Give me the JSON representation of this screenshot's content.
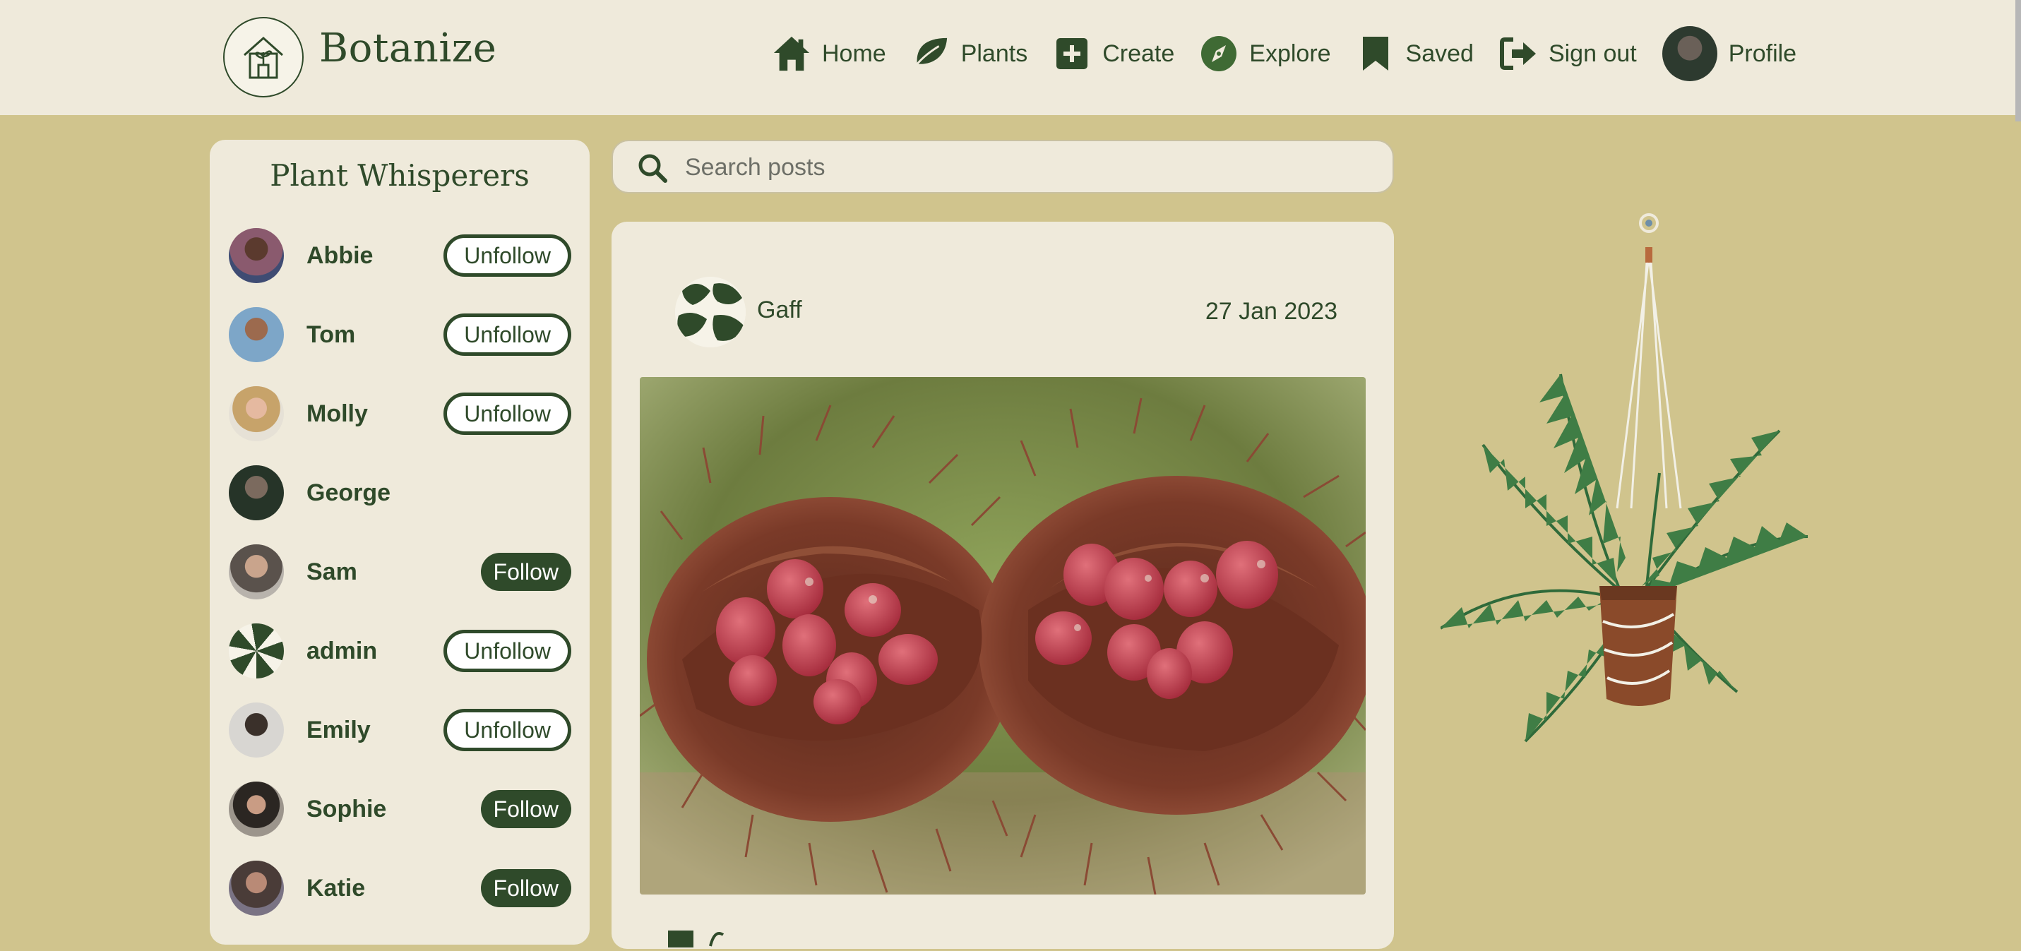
{
  "navbar": {
    "brand": "Botanize",
    "items": [
      {
        "label": "Home",
        "icon": "home-icon"
      },
      {
        "label": "Plants",
        "icon": "leaf-icon"
      },
      {
        "label": "Create",
        "icon": "plus-square-icon"
      },
      {
        "label": "Explore",
        "icon": "compass-icon"
      },
      {
        "label": "Saved",
        "icon": "bookmark-icon"
      },
      {
        "label": "Sign out",
        "icon": "sign-out-icon"
      },
      {
        "label": "Profile",
        "icon": "avatar"
      }
    ]
  },
  "sidebar": {
    "title": "Plant Whisperers",
    "users": [
      {
        "name": "Abbie",
        "action": "Unfollow"
      },
      {
        "name": "Tom",
        "action": "Unfollow"
      },
      {
        "name": "Molly",
        "action": "Unfollow"
      },
      {
        "name": "George",
        "action": ""
      },
      {
        "name": "Sam",
        "action": "Follow"
      },
      {
        "name": "admin",
        "action": "Unfollow"
      },
      {
        "name": "Emily",
        "action": "Unfollow"
      },
      {
        "name": "Sophie",
        "action": "Follow"
      },
      {
        "name": "Katie",
        "action": "Follow"
      }
    ]
  },
  "search": {
    "placeholder": "Search posts",
    "value": ""
  },
  "post": {
    "author": "Gaff",
    "date": "27 Jan 2023"
  },
  "colors": {
    "primary": "#2f4a2a",
    "background": "#d0c48d",
    "card": "#efeadb"
  }
}
